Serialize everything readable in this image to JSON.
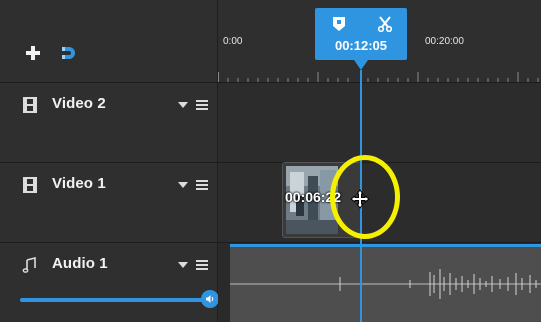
{
  "ruler": {
    "labels": [
      "0:00",
      "00:20:00"
    ]
  },
  "playhead": {
    "time": "00:12:05"
  },
  "tracks": [
    {
      "name": "Video 2",
      "icon": "film-icon"
    },
    {
      "name": "Video 1",
      "icon": "film-icon"
    },
    {
      "name": "Audio 1",
      "icon": "music-note-icon"
    }
  ],
  "clip": {
    "label": "00:06:22"
  },
  "audio": {
    "volume_fraction": 1.0
  },
  "colors": {
    "accent": "#2f95e0",
    "highlight": "#f4f000",
    "background": "#2d2d2d"
  }
}
